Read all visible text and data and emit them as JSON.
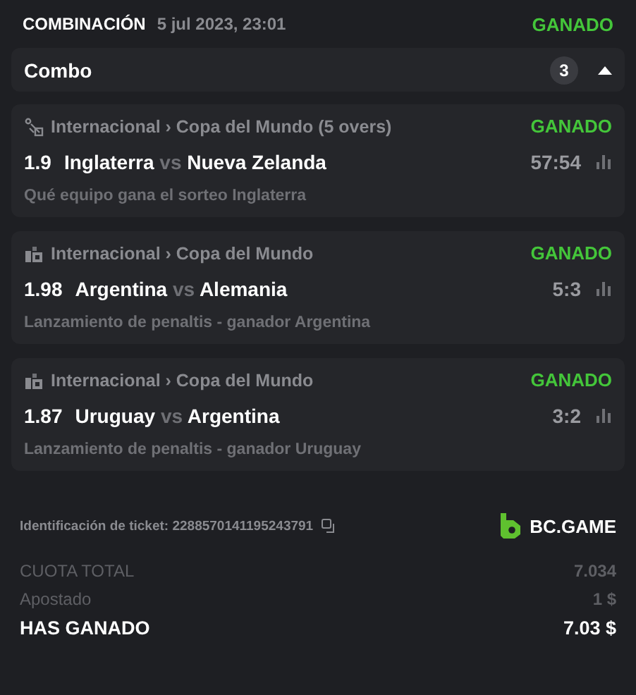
{
  "header": {
    "title": "COMBINACIÓN",
    "date": "5 jul 2023, 23:01",
    "status": "GANADO"
  },
  "combo": {
    "label": "Combo",
    "count": "3",
    "expanded": true
  },
  "selections": [
    {
      "kind": "cricket",
      "league": "Internacional › Copa del Mundo (5 overs)",
      "status": "GANADO",
      "odds": "1.9",
      "home": "Inglaterra",
      "vs": "vs",
      "away": "Nueva Zelanda",
      "score": "57:54",
      "market": "Qué equipo gana el sorteo Inglaterra"
    },
    {
      "kind": "penalty",
      "league": "Internacional › Copa del Mundo",
      "status": "GANADO",
      "odds": "1.98",
      "home": "Argentina",
      "vs": "vs",
      "away": "Alemania",
      "score": "5:3",
      "market": "Lanzamiento de penaltis - ganador Argentina"
    },
    {
      "kind": "penalty",
      "league": "Internacional › Copa del Mundo",
      "status": "GANADO",
      "odds": "1.87",
      "home": "Uruguay",
      "vs": "vs",
      "away": "Argentina",
      "score": "3:2",
      "market": "Lanzamiento de penaltis - ganador Uruguay"
    }
  ],
  "ticket": {
    "label": "Identificación de ticket: 2288570141195243791",
    "brand": "BC.GAME"
  },
  "totals": [
    {
      "kind": "muted",
      "label": "CUOTA TOTAL",
      "value": "7.034"
    },
    {
      "kind": "muted",
      "label": "Apostado",
      "value": "1 $"
    },
    {
      "kind": "strong",
      "label": "HAS GANADO",
      "value": "7.03 $"
    }
  ]
}
